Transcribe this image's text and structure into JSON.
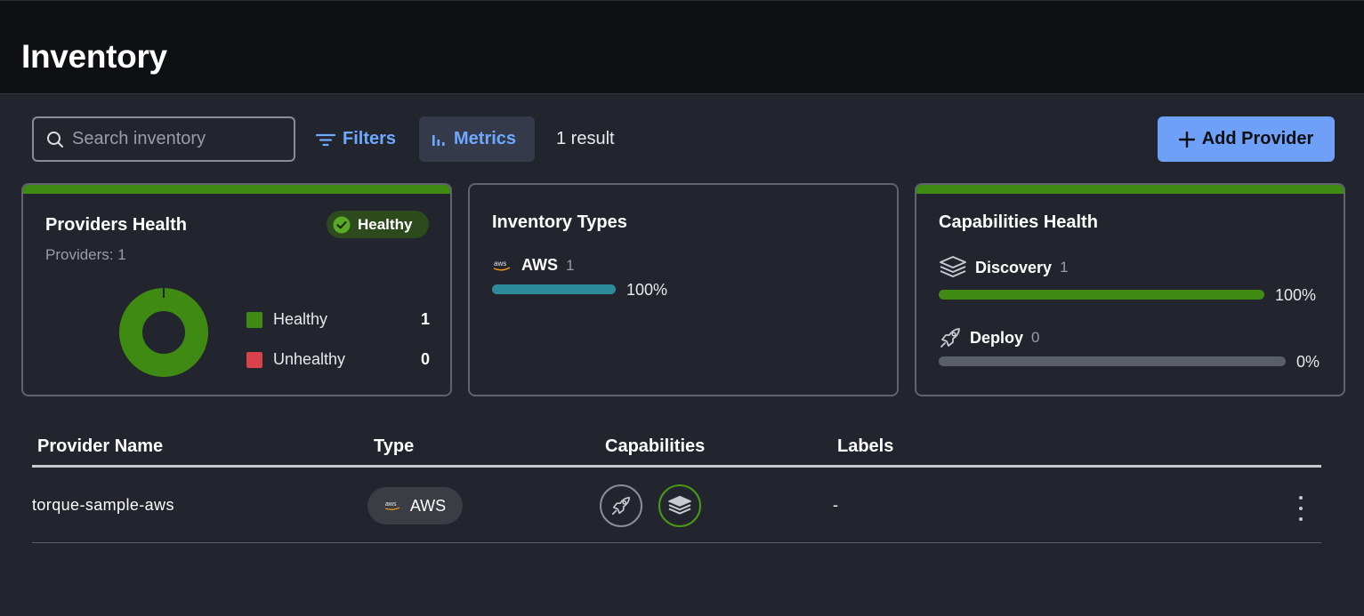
{
  "header": {
    "title": "Inventory"
  },
  "toolbar": {
    "search_placeholder": "Search inventory",
    "filters_label": "Filters",
    "metrics_label": "Metrics",
    "result_count": "1 result",
    "add_provider_label": "Add Provider"
  },
  "providers_health": {
    "title": "Providers Health",
    "badge": "Healthy",
    "subtitle": "Providers: 1",
    "legend": [
      {
        "label": "Healthy",
        "value": "1",
        "color": "#3f8a12"
      },
      {
        "label": "Unhealthy",
        "value": "0",
        "color": "#d9414b"
      }
    ]
  },
  "inventory_types": {
    "title": "Inventory Types",
    "items": [
      {
        "name": "AWS",
        "count": "1",
        "percent": "100%",
        "fill": 1.0,
        "color": "#2e8b9c"
      }
    ]
  },
  "capabilities_health": {
    "title": "Capabilities Health",
    "items": [
      {
        "name": "Discovery",
        "count": "1",
        "percent": "100%",
        "fill": 1.0,
        "color": "#3f8a12"
      },
      {
        "name": "Deploy",
        "count": "0",
        "percent": "0%",
        "fill": 0.0,
        "color": "#3f8a12"
      }
    ]
  },
  "table": {
    "columns": [
      "Provider Name",
      "Type",
      "Capabilities",
      "Labels"
    ],
    "rows": [
      {
        "name": "torque-sample-aws",
        "type": "AWS",
        "labels": "-"
      }
    ]
  },
  "colors": {
    "accent": "#6ea8ff",
    "healthy": "#3f8a12",
    "unhealthy": "#d9414b"
  }
}
